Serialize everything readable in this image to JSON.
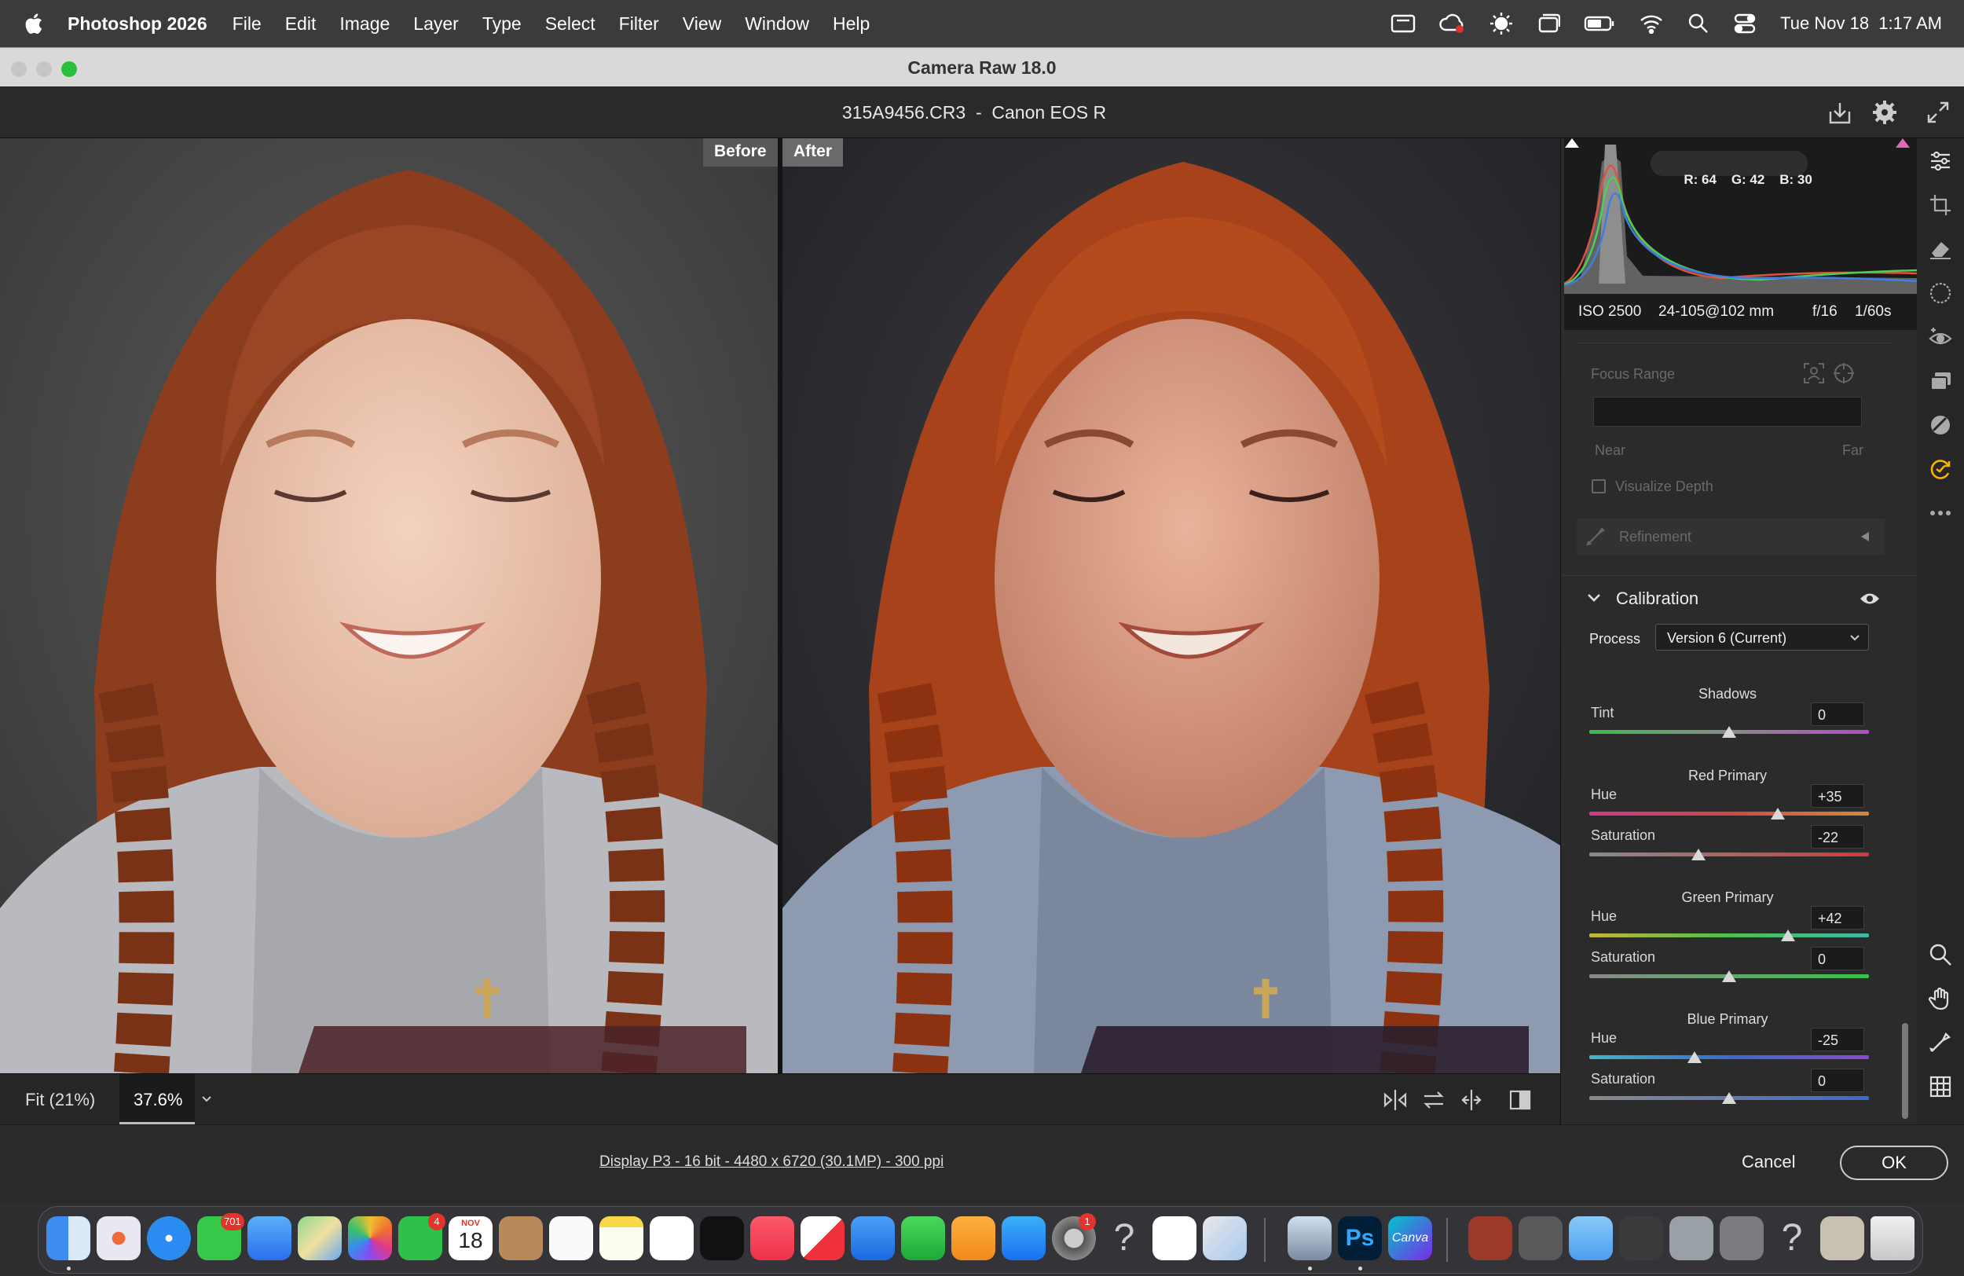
{
  "menubar": {
    "app": "Photoshop 2026",
    "items": [
      "File",
      "Edit",
      "Image",
      "Layer",
      "Type",
      "Select",
      "Filter",
      "View",
      "Window",
      "Help"
    ],
    "clock": "Tue Nov 18  1:17 AM"
  },
  "window": {
    "title": "Camera Raw 18.0"
  },
  "docbar": {
    "filename": "315A9456.CR3  -  Canon EOS R"
  },
  "preview": {
    "before_label": "Before",
    "after_label": "After"
  },
  "bottombar": {
    "fit": "Fit (21%)",
    "zoom": "37.6%"
  },
  "footer": {
    "info": "Display P3 - 16 bit - 4480 x 6720 (30.1MP) - 300 ppi",
    "cancel": "Cancel",
    "ok": "OK"
  },
  "histogram": {
    "r": "R: 64",
    "g": "G: 42",
    "b": "B: 30"
  },
  "exif": {
    "iso": "ISO 2500",
    "lens": "24-105@102 mm",
    "aperture": "f/16",
    "shutter": "1/60s"
  },
  "focus": {
    "label": "Focus Range",
    "near": "Near",
    "far": "Far",
    "visualize": "Visualize Depth",
    "refinement": "Refinement"
  },
  "calibration": {
    "title": "Calibration",
    "process_label": "Process",
    "process_value": "Version 6 (Current)",
    "shadows": {
      "title": "Shadows",
      "tint_label": "Tint",
      "tint": 0
    },
    "red": {
      "title": "Red Primary",
      "hue_label": "Hue",
      "hue": "+35",
      "sat_label": "Saturation",
      "sat": "-22",
      "hue_pos": 0.675,
      "sat_pos": 0.39
    },
    "green": {
      "title": "Green Primary",
      "hue_label": "Hue",
      "hue": "+42",
      "sat_label": "Saturation",
      "sat": "0",
      "hue_pos": 0.71,
      "sat_pos": 0.5
    },
    "blue": {
      "title": "Blue Primary",
      "hue_label": "Hue",
      "hue": "-25",
      "sat_label": "Saturation",
      "sat": "0",
      "hue_pos": 0.375,
      "sat_pos": 0.5
    },
    "tint_value": "0"
  },
  "dock": {
    "messages_badge": "701",
    "facetime_badge": "4",
    "calendar_month": "NOV",
    "calendar_day": "18",
    "settings_badge": "1",
    "ps": "Ps",
    "canva": "Canva"
  }
}
